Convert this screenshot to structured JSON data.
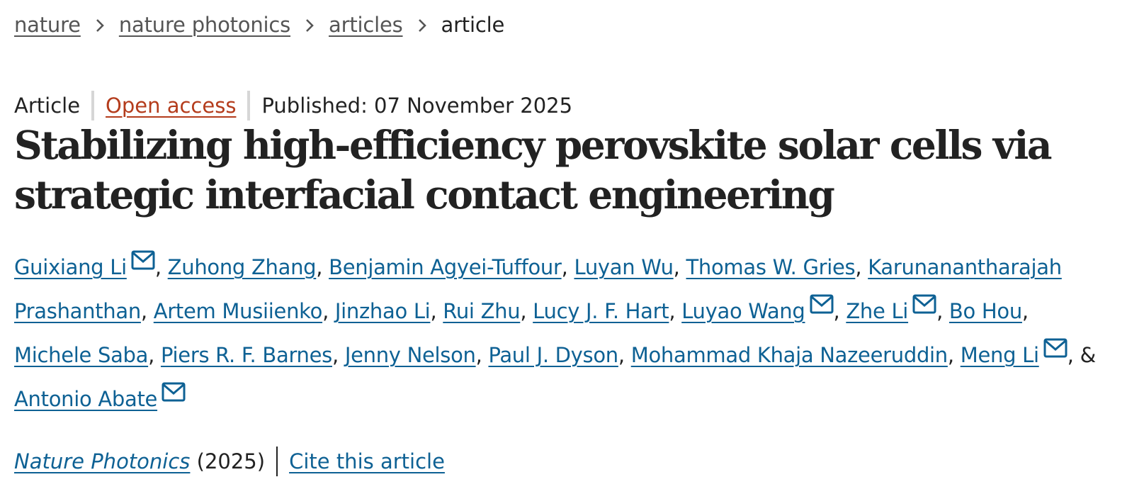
{
  "breadcrumb": {
    "items": [
      {
        "label": "nature"
      },
      {
        "label": "nature photonics"
      },
      {
        "label": "articles"
      }
    ],
    "current": "article"
  },
  "meta": {
    "type": "Article",
    "access": "Open access",
    "published": "Published: 07 November 2025"
  },
  "title": {
    "line1": "Stabilizing high-efficiency perovskite solar cells via",
    "line2": "strategic interfacial contact engineering"
  },
  "authors": [
    {
      "name": "Guixiang Li",
      "mail": true
    },
    {
      "name": "Zuhong Zhang",
      "mail": false
    },
    {
      "name": "Benjamin Agyei-Tuffour",
      "mail": false
    },
    {
      "name": "Luyan Wu",
      "mail": false
    },
    {
      "name": "Thomas W. Gries",
      "mail": false
    },
    {
      "name": "Karunanantharajah Prashanthan",
      "mail": false
    },
    {
      "name": "Artem Musiienko",
      "mail": false
    },
    {
      "name": "Jinzhao Li",
      "mail": false
    },
    {
      "name": "Rui Zhu",
      "mail": false
    },
    {
      "name": "Lucy J. F. Hart",
      "mail": false
    },
    {
      "name": "Luyao Wang",
      "mail": true
    },
    {
      "name": "Zhe Li",
      "mail": true
    },
    {
      "name": "Bo Hou",
      "mail": false
    },
    {
      "name": "Michele Saba",
      "mail": false
    },
    {
      "name": "Piers R. F. Barnes",
      "mail": false
    },
    {
      "name": "Jenny Nelson",
      "mail": false
    },
    {
      "name": "Paul J. Dyson",
      "mail": false
    },
    {
      "name": "Mohammad Khaja Nazeeruddin",
      "mail": false
    },
    {
      "name": "Meng Li",
      "mail": true
    },
    {
      "name": "Antonio Abate",
      "mail": true
    }
  ],
  "authors_separator": ", ",
  "authors_last_conjunction": "& ",
  "citation": {
    "journal": "Nature Photonics",
    "year": "(2025)",
    "cite_label": "Cite this article"
  },
  "colors": {
    "link": "#0e6194",
    "open_access": "#b43c1c",
    "breadcrumb_link": "#555555",
    "text": "#222222"
  },
  "icons": {
    "breadcrumb_separator": "chevron-right-icon",
    "author_contact": "envelope-mail-icon"
  }
}
